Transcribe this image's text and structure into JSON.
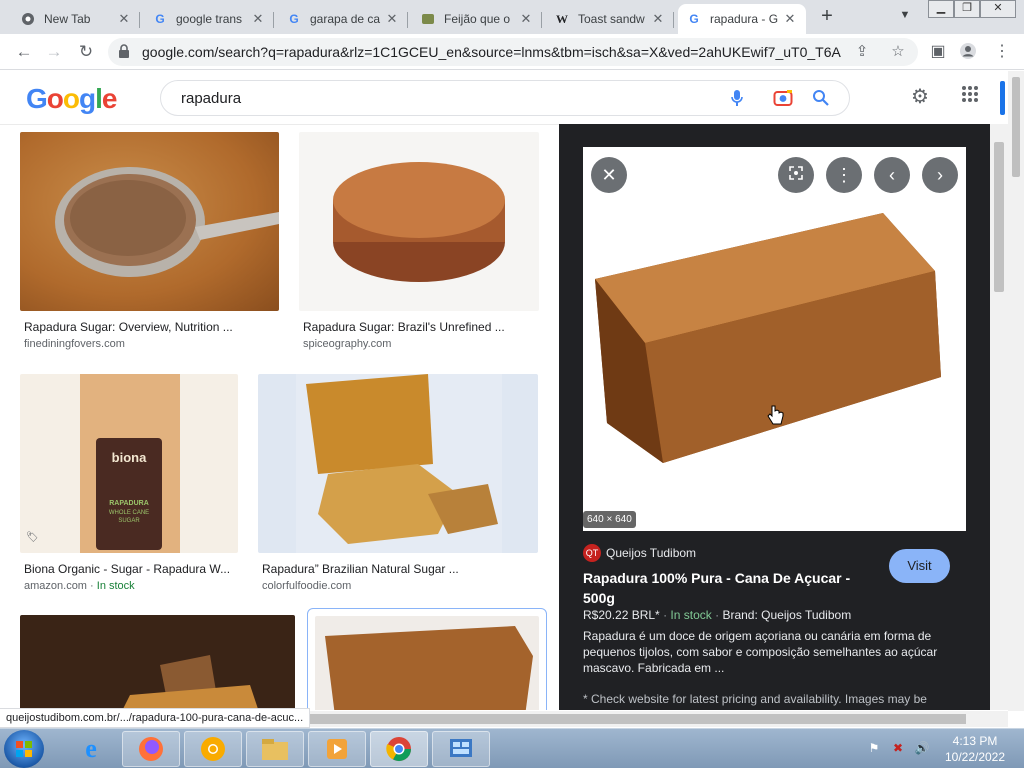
{
  "tabs": [
    {
      "title": "New Tab",
      "icon": "chrome-icon"
    },
    {
      "title": "google trans",
      "icon": "google-icon"
    },
    {
      "title": "garapa de ca",
      "icon": "google-icon"
    },
    {
      "title": "Feijão que o",
      "icon": "site-icon"
    },
    {
      "title": "Toast sandw",
      "icon": "wikipedia-icon"
    },
    {
      "title": "rapadura - G",
      "icon": "google-icon"
    }
  ],
  "address": {
    "url": "google.com/search?q=rapadura&rlz=1C1GCEU_en&source=lnms&tbm=isch&sa=X&ved=2ahUKEwif7_uT0_T6A..."
  },
  "google": {
    "logo": "Google",
    "query": "rapadura"
  },
  "results": [
    {
      "caption": "Rapadura Sugar: Overview, Nutrition ...",
      "source": "finediningfovers.com",
      "in_stock": ""
    },
    {
      "caption": "Rapadura Sugar: Brazil's Unrefined ...",
      "source": "spiceography.com",
      "in_stock": ""
    },
    {
      "caption": "Biona Organic - Sugar - Rapadura W...",
      "source": "amazon.com",
      "in_stock": "In stock"
    },
    {
      "caption": "Rapadura” Brazilian Natural Sugar ...",
      "source": "colorfulfoodie.com",
      "in_stock": ""
    }
  ],
  "biona_label": {
    "brand": "biona",
    "line1": "RAPADURA",
    "line2": "WHOLE CANE",
    "line3": "SUGAR"
  },
  "preview": {
    "dimensions": "640 × 640",
    "store": "Queijos Tudibom",
    "store_badge": "QT",
    "title": "Rapadura 100% Pura - Cana De Açucar - 500g",
    "visit": "Visit",
    "price": "R$20.22 BRL*",
    "stock": "In stock",
    "brand": "Brand: Queijos Tudibom",
    "description": "Rapadura é um doce de origem açoriana ou canária em forma de pequenos tijolos, com sabor e composição semelhantes ao açúcar mascavo. Fabricada em ...",
    "note": "* Check website for latest pricing and availability. Images may be"
  },
  "status_url": "queijostudibom.com.br/.../rapadura-100-pura-cana-de-acuc...",
  "clock": {
    "time": "4:13 PM",
    "date": "10/22/2022"
  },
  "colors": {
    "accent": "#1a73e8",
    "panel_bg": "#202124",
    "visit": "#8ab4f8",
    "stock": "#188038"
  }
}
